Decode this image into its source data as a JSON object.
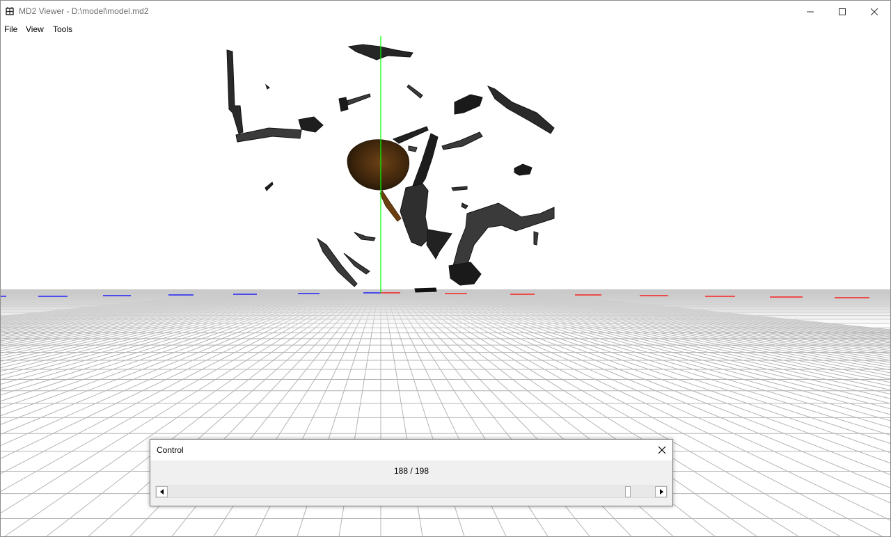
{
  "window": {
    "title": "MD2 Viewer - D:\\model\\model.md2",
    "icon": "grid-app-icon"
  },
  "menu": {
    "items": [
      {
        "label": "File"
      },
      {
        "label": "View"
      },
      {
        "label": "Tools"
      }
    ]
  },
  "control_panel": {
    "title": "Control",
    "frame_text": "188 / 198",
    "frame_current": 188,
    "frame_total": 198
  },
  "colors": {
    "axis_y": "#00ff00",
    "axis_x_negative": "#0000ff",
    "axis_x_positive": "#ff0000",
    "grid": "#b4b4b4",
    "model_dark": "#1f1f1f",
    "model_brown": "#5a3410"
  }
}
